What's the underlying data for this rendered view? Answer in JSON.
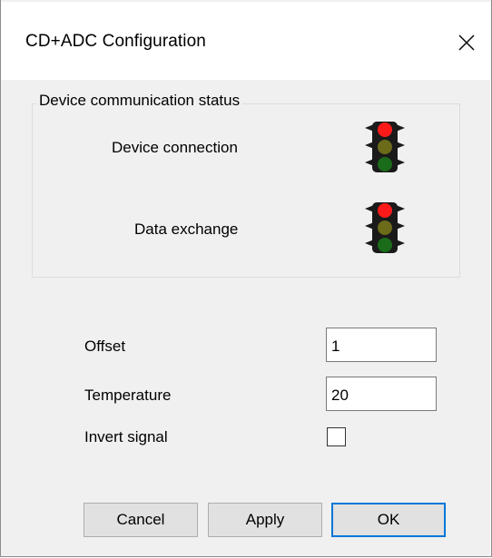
{
  "window": {
    "title": "CD+ADC Configuration",
    "close_icon": "close-icon"
  },
  "status_group": {
    "legend": "Device communication status",
    "items": [
      {
        "label": "Device connection",
        "icon": "traffic-light-icon",
        "state": "red"
      },
      {
        "label": "Data exchange",
        "icon": "traffic-light-icon",
        "state": "red"
      }
    ]
  },
  "fields": {
    "offset": {
      "label": "Offset",
      "value": "1"
    },
    "temperature": {
      "label": "Temperature",
      "value": "20"
    },
    "invert": {
      "label": "Invert signal",
      "checked": false
    }
  },
  "buttons": {
    "cancel": "Cancel",
    "apply": "Apply",
    "ok": "OK"
  },
  "colors": {
    "light_red": "#ff1a1a",
    "light_yellow_off": "#6b6b1a",
    "light_green_off": "#1a6b1a",
    "default_button_border": "#0078d7",
    "dialog_bg": "#f0f0f0"
  }
}
